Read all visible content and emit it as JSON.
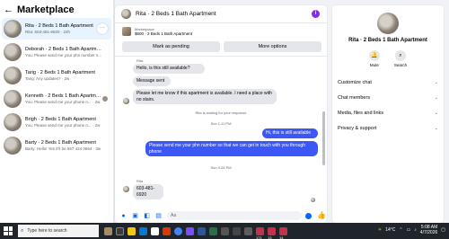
{
  "left": {
    "back_label": "←",
    "title": "Marketplace",
    "conversations": [
      {
        "name": "Rita · 2 Beds 1 Bath Apartment",
        "preview": "Rita: 603-481-6920 · 22h",
        "active": true
      },
      {
        "name": "Deborah · 2 Beds 1 Bath Apartment",
        "preview": "You: Please send me your phn number s... · 1d",
        "active": false
      },
      {
        "name": "Tarig · 2 Beds 1 Bath Apartment",
        "preview": "Tarig: Any updates? · 2w",
        "active": false
      },
      {
        "name": "Kenneth · 2 Beds 1 Bath Apartme...",
        "preview": "You: Please send me your phone n... · 2w",
        "active": false
      },
      {
        "name": "Brigh · 2 Beds 1 Bath Apartment",
        "preview": "You: Please send me your phone n... · 2w",
        "active": false
      },
      {
        "name": "Barty · 2 Beds 1 Bath Apartment",
        "preview": "Barty: Hello! Yes it'll be 567 424 0664 · 3w",
        "active": false
      }
    ],
    "more_label": "···"
  },
  "center": {
    "header_title": "Rita · 2 Beds 1 Bath Apartment",
    "info_label": "i",
    "listing_label": "Marketplace",
    "listing_price": "$600 · 2 Beds 1 Bath Apartment",
    "btn_pending": "Mark as pending",
    "btn_more": "More options",
    "messages": {
      "top_sender": "Rita",
      "m1": "Hello, is this still available?",
      "m2": "Message sent",
      "m3": "Please let me know if this apartment is available. I need a place with no stairs.",
      "waiting": "Rita is waiting for your response",
      "time1": "Sun 1:11 PM",
      "m4": "Hi, this is still available",
      "m5": "Please send me your phn number so that we can get in touch with you through phone",
      "time2": "Sun 4:28 PM",
      "bottom_sender": "Rita",
      "m6": "603-481-6920"
    },
    "composer_placeholder": "Aa"
  },
  "right": {
    "title": "Rita · 2 Beds 1 Bath Apartment",
    "mute_label": "Mute",
    "search_label": "Search",
    "rows": [
      "Customize chat",
      "Chat members",
      "Media, files and links",
      "Privacy & support"
    ]
  },
  "taskbar": {
    "search_placeholder": "Type here to search",
    "temperature": "14°C",
    "time": "5:08 AM",
    "date": "4/7/2026",
    "badges": [
      "171",
      "13",
      "14"
    ]
  },
  "colors": {
    "accent": "#0866ff",
    "outgoing_bubble": "#3b57f5",
    "incoming_bubble": "#e4e6eb",
    "taskbar": "#20252b"
  }
}
